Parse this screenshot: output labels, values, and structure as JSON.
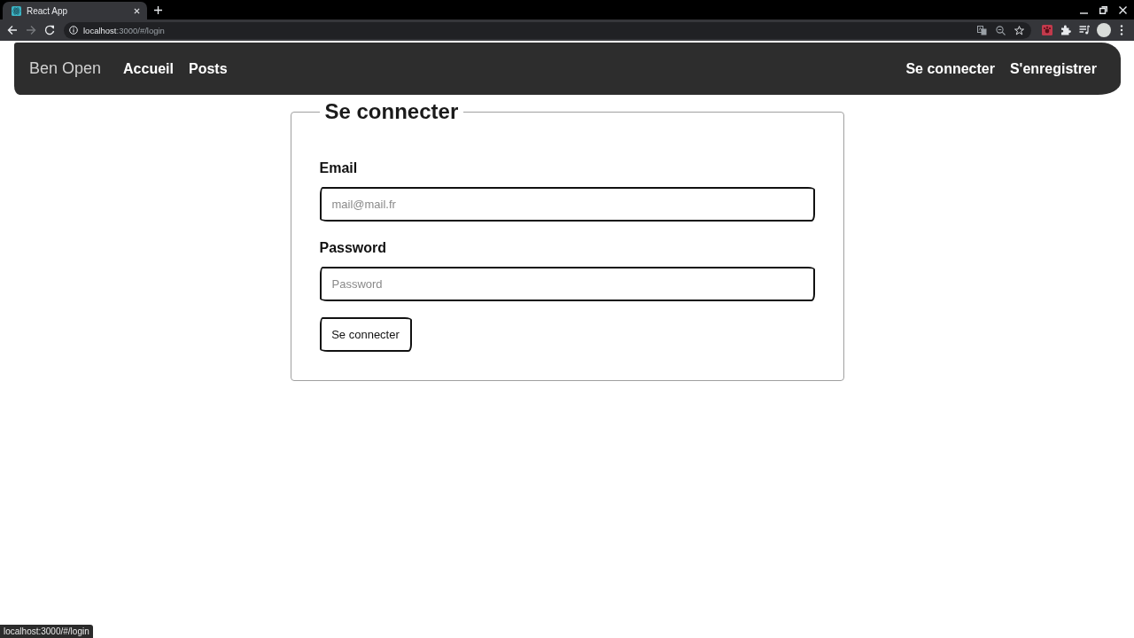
{
  "browser": {
    "tab": {
      "title": "React App"
    },
    "forward": {
      "disabled": true
    },
    "address": "**localhost**:3000/#/login"
  },
  "navbar": {
    "brand": "Ben Open",
    "links": [
      {
        "label": "Accueil"
      },
      {
        "label": "Posts"
      }
    ],
    "right_links": [
      {
        "label": "Se connecter"
      },
      {
        "label": "S'enregistrer"
      }
    ]
  },
  "form": {
    "legend": "Se connecter",
    "fields": [
      {
        "label": "Email",
        "placeholder": "mail@mail.fr"
      },
      {
        "label": "Password",
        "placeholder": "Password"
      }
    ],
    "submit": "Se connecter"
  },
  "status_bar": {
    "url": "localhost:3000/#/login"
  }
}
